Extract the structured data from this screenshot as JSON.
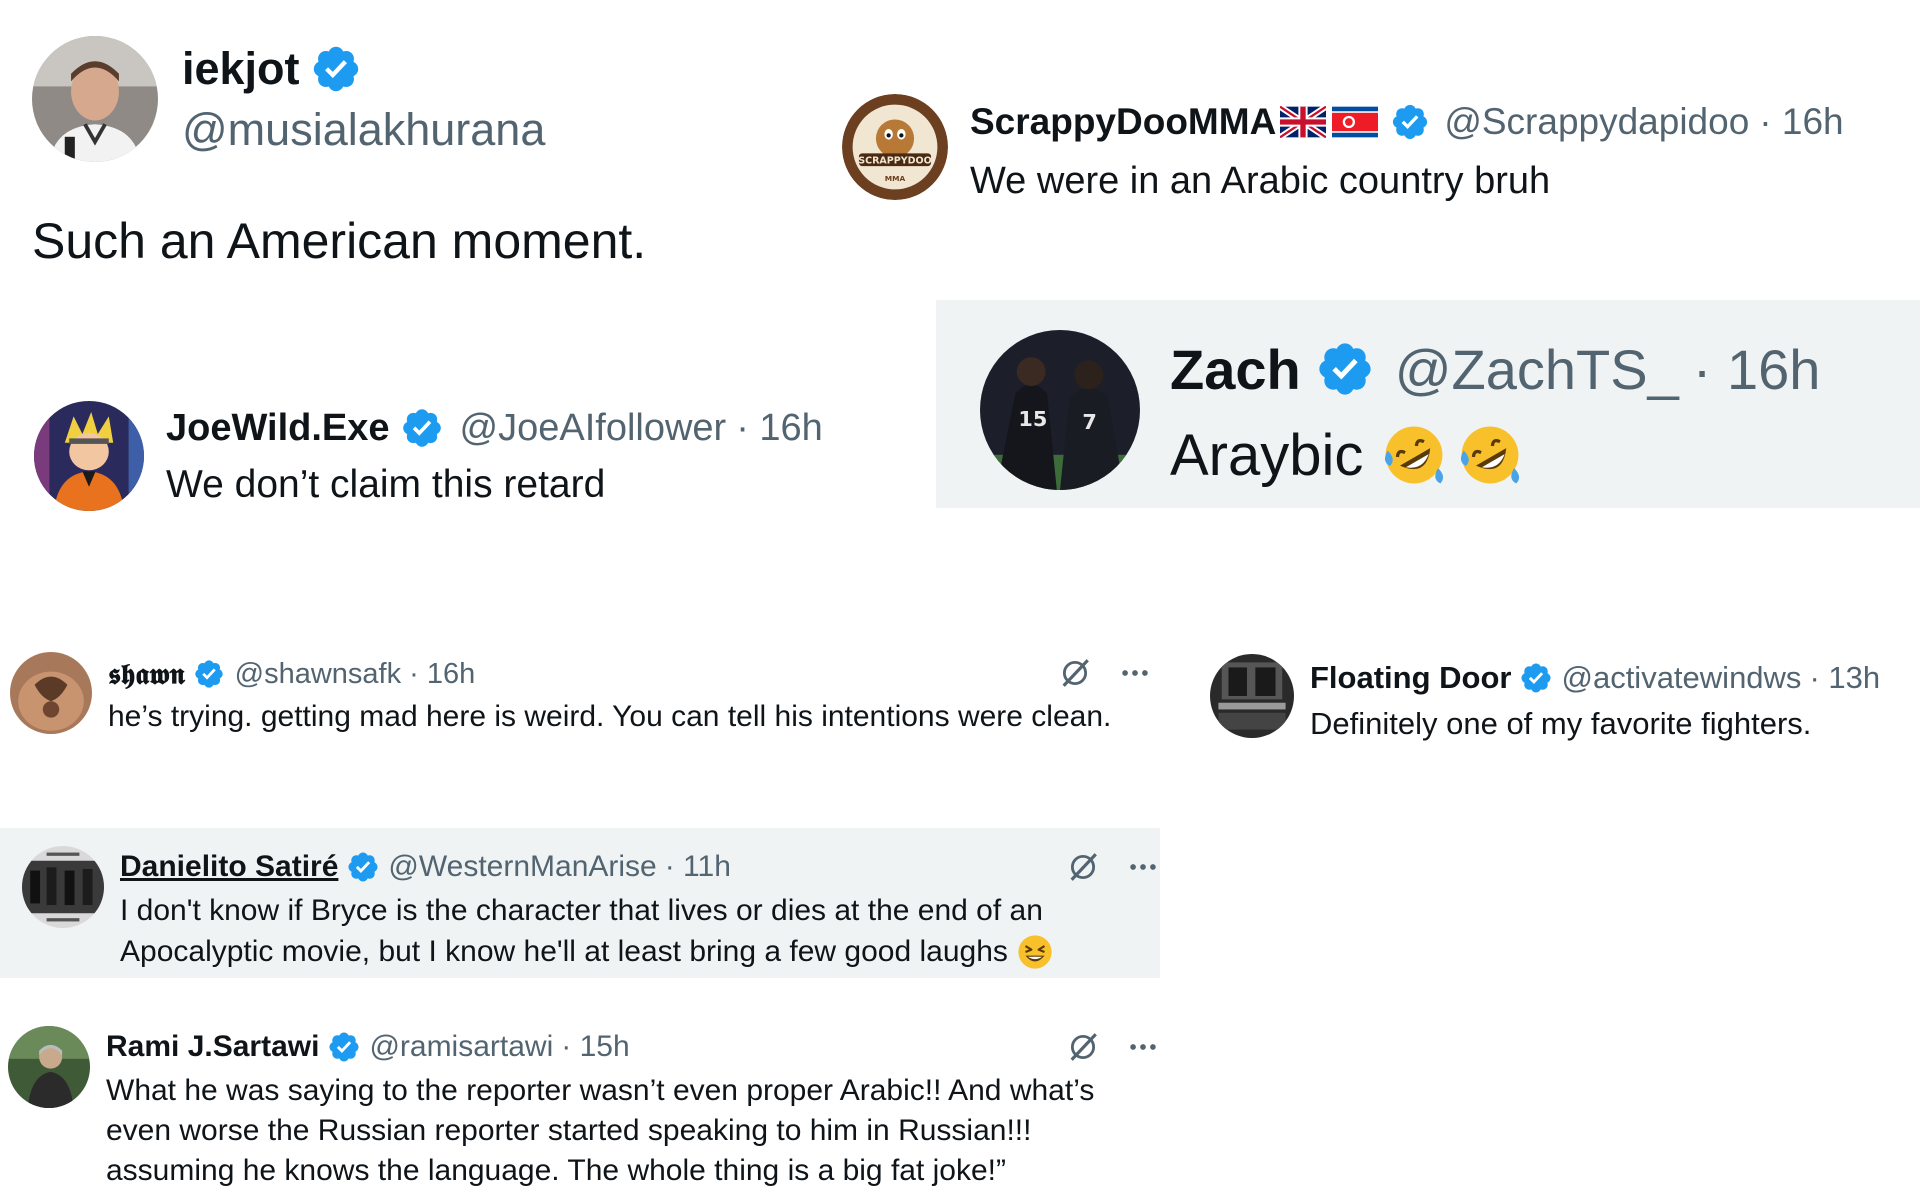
{
  "tweets": [
    {
      "name": "iekjot",
      "handle": "@musialakhurana",
      "text": "Such an American moment.",
      "verified": true
    },
    {
      "name": "ScrappyDooMMA",
      "flags": [
        "uk-flag",
        "north-korea-flag"
      ],
      "handle": "@Scrappydapidoo",
      "time": "· 16h",
      "text": "We were in an Arabic country bruh",
      "avatar_label": "SCRAPPYDOO",
      "avatar_sublabel": "MMA",
      "verified": true
    },
    {
      "name": "JoeWild.Exe",
      "handle": "@JoeAIfollower",
      "time": "· 16h",
      "text": "We don’t claim this retard",
      "verified": true
    },
    {
      "name": "Zach",
      "handle": "@ZachTS_",
      "time": "· 16h",
      "text": "Araybic",
      "emoji": [
        "rolling-on-floor-laughing",
        "rolling-on-floor-laughing"
      ],
      "jersey_numbers": [
        "15",
        "7"
      ],
      "verified": true
    },
    {
      "name": "𝖘𝖍𝖆𝖜𝖓",
      "handle": "@shawnsafk",
      "time": "· 16h",
      "text": "he’s trying. getting mad here is weird. You can tell his intentions were clean.",
      "verified": true
    },
    {
      "name": "Floating Door",
      "handle": "@activatewindws",
      "time": "· 13h",
      "text": "Definitely one of my favorite fighters.",
      "verified": true
    },
    {
      "name": "Danielito Satiré",
      "handle": "@WesternManArise",
      "time": "· 11h",
      "text_lines": [
        "I don't know if Bryce is the character that lives or dies at the end of an",
        "Apocalyptic movie, but I know he'll at least bring a few good laughs"
      ],
      "emoji": [
        "grinning-squinting-face"
      ],
      "verified": true
    },
    {
      "name": "Rami J.Sartawi",
      "handle": "@ramisartawi",
      "time": "· 15h",
      "text_lines": [
        "What he was saying to the reporter wasn’t even proper Arabic!! And what’s",
        "even worse the Russian reporter started speaking to him in Russian!!!",
        "assuming he knows the language. The whole thing is a big fat joke!”"
      ],
      "verified": true
    }
  ],
  "icons": {
    "verified": "verified-badge-icon",
    "grok": "grok-icon",
    "more": "more-icon"
  },
  "colors": {
    "verified_blue": "#1d9bf0",
    "gray_card": "#eff3f4",
    "secondary_text": "#536471",
    "primary_text": "#0f1419"
  }
}
